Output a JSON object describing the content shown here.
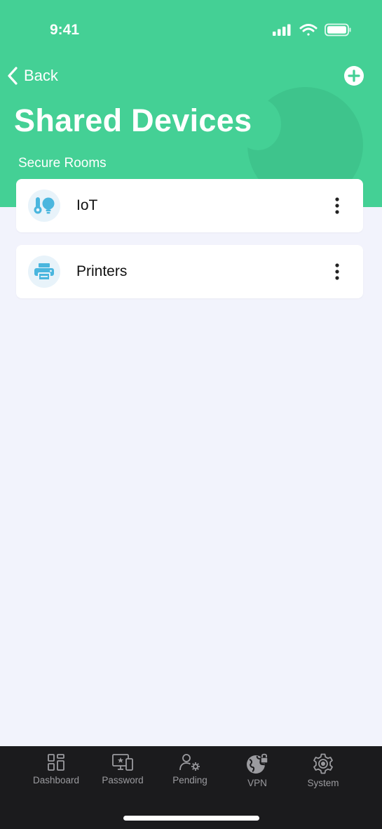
{
  "status_bar": {
    "time": "9:41"
  },
  "nav": {
    "back_label": "Back"
  },
  "header": {
    "title": "Shared Devices",
    "section_label": "Secure Rooms"
  },
  "rooms": [
    {
      "label": "IoT",
      "icon": "iot-icon"
    },
    {
      "label": "Printers",
      "icon": "printer-icon"
    }
  ],
  "tabbar": {
    "items": [
      {
        "label": "Dashboard",
        "icon": "dashboard-icon"
      },
      {
        "label": "Password",
        "icon": "password-icon"
      },
      {
        "label": "Pending",
        "icon": "pending-icon"
      },
      {
        "label": "VPN",
        "icon": "vpn-icon"
      },
      {
        "label": "System",
        "icon": "system-icon"
      }
    ]
  },
  "colors": {
    "header_green": "#44D095",
    "background": "#F2F3FC",
    "icon_blue": "#4AB6DE",
    "tabbar": "#1B1B1D"
  }
}
